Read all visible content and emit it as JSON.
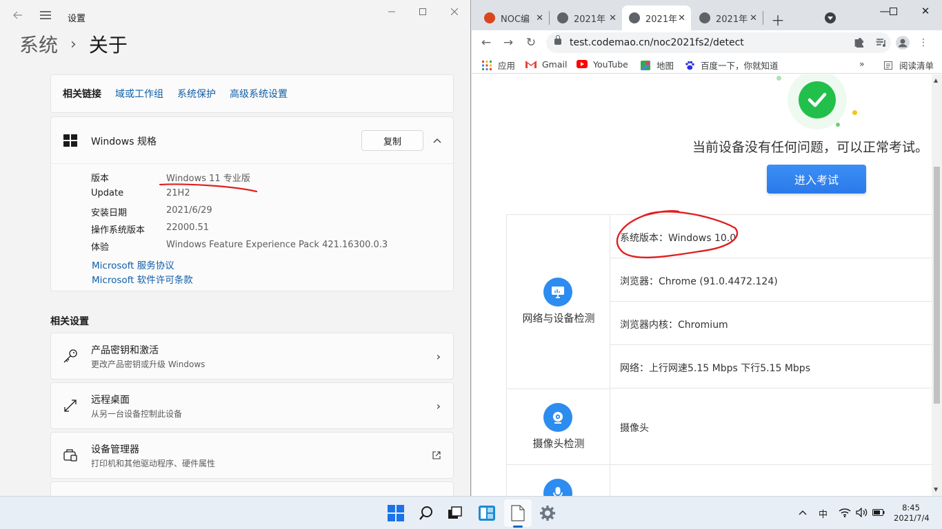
{
  "settings": {
    "window_title": "设置",
    "breadcrumb": {
      "parent": "系统",
      "separator": "›",
      "current": "关于"
    },
    "related_links": {
      "label": "相关链接",
      "links": [
        "域或工作组",
        "系统保护",
        "高级系统设置"
      ]
    },
    "windows_spec": {
      "title": "Windows 规格",
      "copy_button": "复制",
      "rows": [
        {
          "key": "版本",
          "value": "Windows 11 专业版"
        },
        {
          "key": "Update",
          "value": "21H2"
        },
        {
          "key": "安装日期",
          "value": "2021/6/29"
        },
        {
          "key": "操作系统版本",
          "value": "22000.51"
        },
        {
          "key": "体验",
          "value": "Windows Feature Experience Pack 421.16300.0.3"
        }
      ],
      "links": [
        "Microsoft 服务协议",
        "Microsoft 软件许可条款"
      ]
    },
    "related_settings": {
      "title": "相关设置",
      "items": [
        {
          "title": "产品密钥和激活",
          "subtitle": "更改产品密钥或升级 Windows",
          "icon": "key-icon"
        },
        {
          "title": "远程桌面",
          "subtitle": "从另一台设备控制此设备",
          "icon": "remote-desktop-icon"
        },
        {
          "title": "设备管理器",
          "subtitle": "打印机和其他驱动程序、硬件属性",
          "icon": "device-manager-icon"
        }
      ]
    }
  },
  "chrome": {
    "tabs": [
      {
        "title": "NOC编",
        "active": false,
        "favicon": "noc-favicon"
      },
      {
        "title": "2021年",
        "active": false,
        "favicon": "globe-favicon"
      },
      {
        "title": "2021年",
        "active": true,
        "favicon": "globe-favicon"
      },
      {
        "title": "2021年",
        "active": false,
        "favicon": "globe-favicon"
      }
    ],
    "url": "test.codemao.cn/noc2021fs2/detect",
    "bookmarks": [
      "应用",
      "Gmail",
      "YouTube",
      "地图",
      "百度一下，你就知道"
    ],
    "reading_list": "阅读清单",
    "page": {
      "status_message": "当前设备没有任何问题，可以正常考试。",
      "enter_button": "进入考试",
      "groups": [
        {
          "name": "网络与设备检测",
          "icon": "monitor-icon",
          "rows": [
            "系统版本：Windows 10.0",
            "浏览器：Chrome (91.0.4472.124)",
            "浏览器内核：Chromium",
            "网络：上行网速5.15 Mbps 下行5.15 Mbps"
          ]
        },
        {
          "name": "摄像头检测",
          "icon": "camera-icon",
          "rows": [
            "摄像头"
          ]
        },
        {
          "name": "",
          "icon": "microphone-icon",
          "rows": []
        }
      ],
      "colors": {
        "success": "#22c04a",
        "primary": "#2d8cf0",
        "annotation": "#e02020"
      }
    }
  },
  "taskbar": {
    "tray": {
      "ime": "中"
    },
    "clock": {
      "time": "8:45",
      "date": "2021/7/4"
    }
  }
}
